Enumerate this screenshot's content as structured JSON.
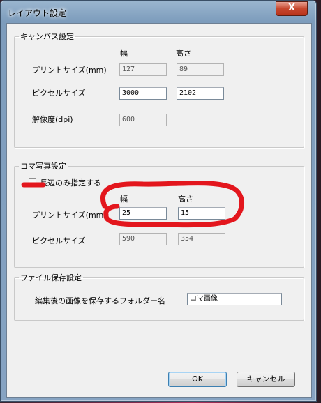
{
  "window": {
    "title": "レイアウト設定",
    "close_glyph": "X"
  },
  "canvas": {
    "legend": "キャンバス設定",
    "width_header": "幅",
    "height_header": "高さ",
    "print_size_label": "プリントサイズ(mm)",
    "print_size_width": "127",
    "print_size_height": "89",
    "pixel_size_label": "ピクセルサイズ",
    "pixel_size_width": "3000",
    "pixel_size_height": "2102",
    "resolution_label": "解像度(dpi)",
    "resolution_value": "600"
  },
  "frame": {
    "legend": "コマ写真設定",
    "long_side_only_label": "長辺のみ指定する",
    "long_side_only_checked": false,
    "width_header": "幅",
    "height_header": "高さ",
    "print_size_label": "プリントサイズ(mm)",
    "print_size_width": "25",
    "print_size_height": "15",
    "pixel_size_label": "ピクセルサイズ",
    "pixel_size_width": "590",
    "pixel_size_height": "354"
  },
  "save": {
    "legend": "ファイル保存設定",
    "folder_label": "編集後の画像を保存するフォルダー名",
    "folder_value": "コマ画像"
  },
  "buttons": {
    "ok_label": "OK",
    "cancel_label": "キャンセル"
  },
  "colors": {
    "annotation": "#e3161d"
  }
}
